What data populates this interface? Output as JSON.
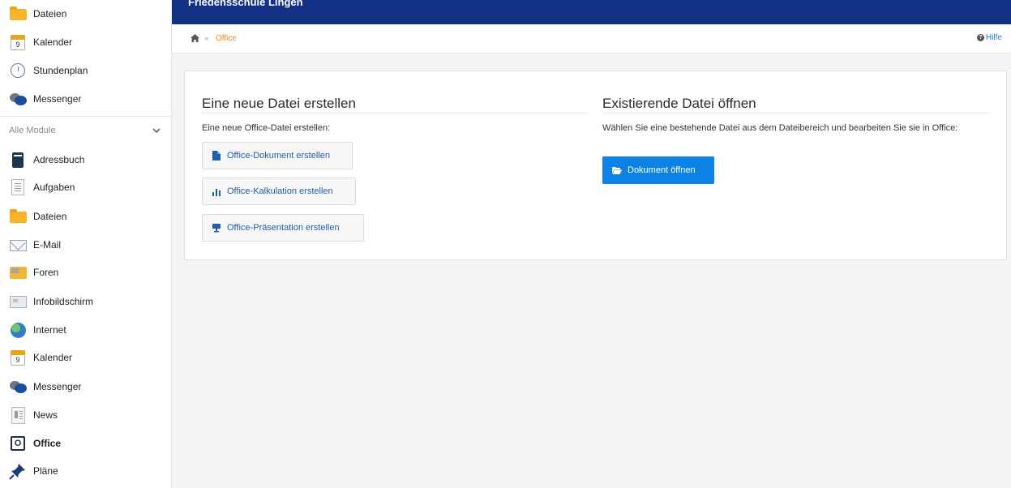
{
  "sidebar": {
    "top_items": [
      {
        "label": "Dateien",
        "icon": "folder-icon"
      },
      {
        "label": "Kalender",
        "icon": "calendar-icon",
        "icon_text": "9"
      },
      {
        "label": "Stundenplan",
        "icon": "clock-icon"
      },
      {
        "label": "Messenger",
        "icon": "chat-bubbles-icon"
      }
    ],
    "section_label": "Alle Module",
    "modules": [
      {
        "label": "Adressbuch",
        "icon": "address-book-icon"
      },
      {
        "label": "Aufgaben",
        "icon": "task-list-icon"
      },
      {
        "label": "Dateien",
        "icon": "folder-icon"
      },
      {
        "label": "E-Mail",
        "icon": "envelope-icon"
      },
      {
        "label": "Foren",
        "icon": "forum-icon"
      },
      {
        "label": "Infobildschirm",
        "icon": "info-screen-icon"
      },
      {
        "label": "Internet",
        "icon": "globe-icon"
      },
      {
        "label": "Kalender",
        "icon": "calendar-icon",
        "icon_text": "9"
      },
      {
        "label": "Messenger",
        "icon": "chat-bubbles-icon"
      },
      {
        "label": "News",
        "icon": "news-icon"
      },
      {
        "label": "Office",
        "icon": "office-icon",
        "icon_text": "O",
        "active": true
      },
      {
        "label": "Pläne",
        "icon": "pushpin-icon"
      }
    ]
  },
  "header": {
    "school_name": "Friedensschule Lingen"
  },
  "breadcrumb": {
    "separator": "»",
    "current": "Office",
    "help_label": "Hilfe",
    "help_icon_text": "?"
  },
  "main": {
    "create": {
      "title": "Eine neue Datei erstellen",
      "description": "Eine neue Office-Datei erstellen:",
      "buttons": [
        {
          "label": "Office-Dokument erstellen",
          "icon": "document-icon"
        },
        {
          "label": "Office-Kalkulation erstellen",
          "icon": "bar-chart-icon"
        },
        {
          "label": "Office-Präsentation erstellen",
          "icon": "presentation-icon"
        }
      ]
    },
    "open": {
      "title": "Existierende Datei öffnen",
      "description": "Wählen Sie eine bestehende Datei aus dem Dateibereich und bearbeiten Sie sie in Office:",
      "button_label": "Dokument öffnen",
      "button_icon": "folder-open-icon"
    }
  },
  "colors": {
    "header_bg": "#123185",
    "primary_button": "#0d82e6",
    "link": "#1f5ea8",
    "breadcrumb_active": "#f08a24"
  }
}
